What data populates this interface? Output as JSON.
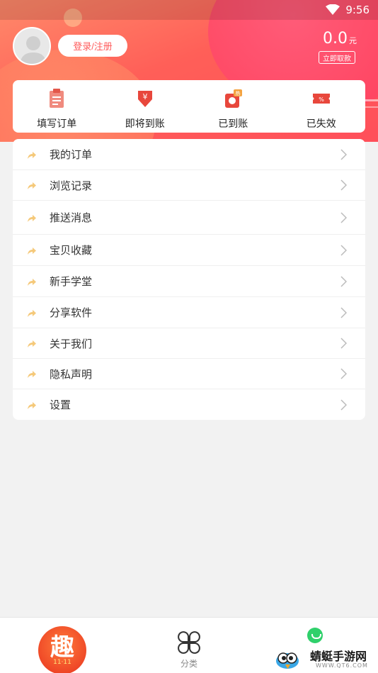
{
  "status_bar": {
    "time": "9:56"
  },
  "profile": {
    "login_label": "登录/注册",
    "balance": "0.0",
    "balance_unit": "元",
    "withdraw_label": "立即取款"
  },
  "orders": [
    {
      "label": "填写订单",
      "icon": "clipboard-icon"
    },
    {
      "label": "即将到账",
      "icon": "yen-down-icon"
    },
    {
      "label": "已到账",
      "icon": "hot-coupon-icon"
    },
    {
      "label": "已失效",
      "icon": "percent-ticket-icon"
    }
  ],
  "menu": [
    {
      "label": "我的订单"
    },
    {
      "label": "浏览记录"
    },
    {
      "label": "推送消息"
    },
    {
      "label": "宝贝收藏"
    },
    {
      "label": "新手学堂"
    },
    {
      "label": "分享软件"
    },
    {
      "label": "关于我们"
    },
    {
      "label": "隐私声明"
    },
    {
      "label": "设置"
    }
  ],
  "bottom_nav": {
    "home_char": "趣",
    "home_sub": "11·11",
    "category_label": "分类"
  },
  "watermark": {
    "title": "蜻蜓手游网",
    "url": "WWW.QT6.COM"
  },
  "colors": {
    "accent": "#ff5a5a",
    "menu_arrow": "#f5c97a",
    "header": "#ff5f58"
  }
}
